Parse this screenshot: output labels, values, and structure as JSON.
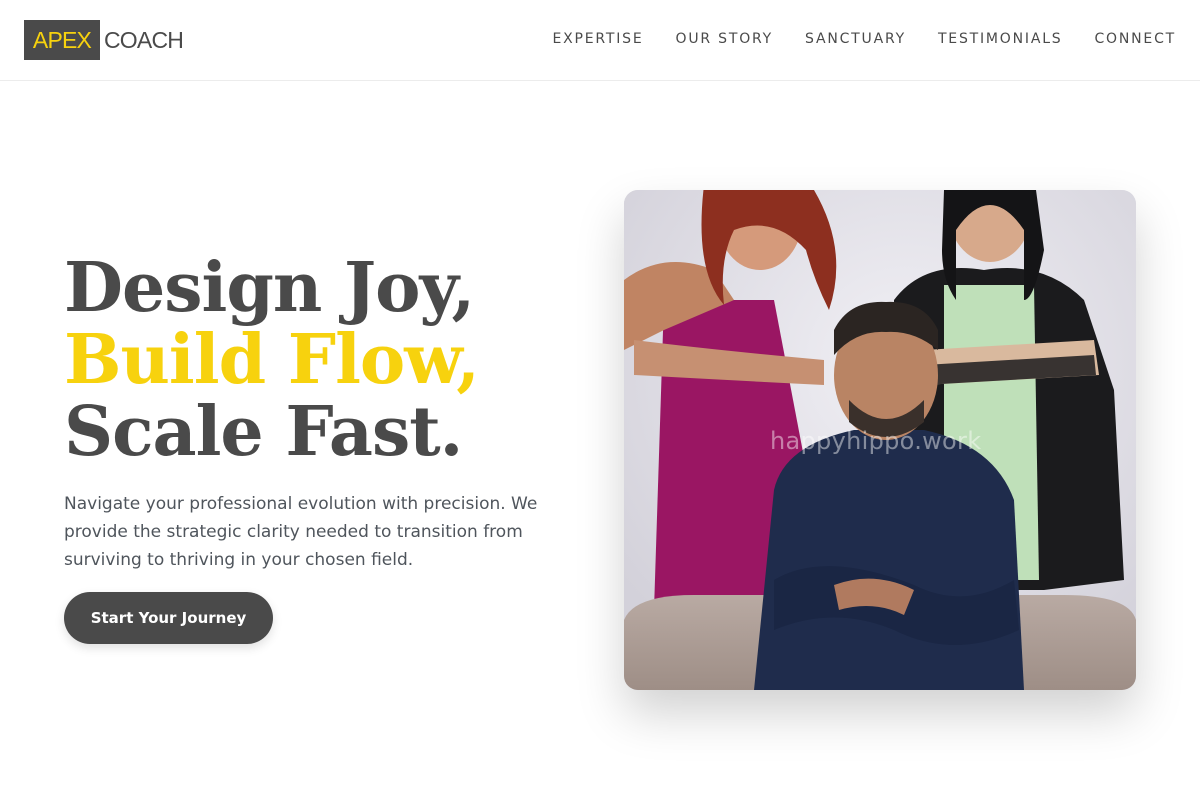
{
  "brand": {
    "mark": "APEX",
    "word": "COACH",
    "accent_color": "#f7d20e",
    "dark_color": "#4a4a4a"
  },
  "nav": {
    "items": [
      {
        "label": "EXPERTISE"
      },
      {
        "label": "OUR STORY"
      },
      {
        "label": "SANCTUARY"
      },
      {
        "label": "TESTIMONIALS"
      },
      {
        "label": "CONNECT"
      }
    ]
  },
  "hero": {
    "title_line1": "Design Joy,",
    "title_line2": "Build Flow,",
    "title_line3": "Scale Fast.",
    "description": "Navigate your professional evolution with precision. We provide the strategic clarity needed to transition from surviving to thriving in your chosen field.",
    "cta_label": "Start Your Journey"
  },
  "photo": {
    "watermark": "happyhippo.work"
  }
}
